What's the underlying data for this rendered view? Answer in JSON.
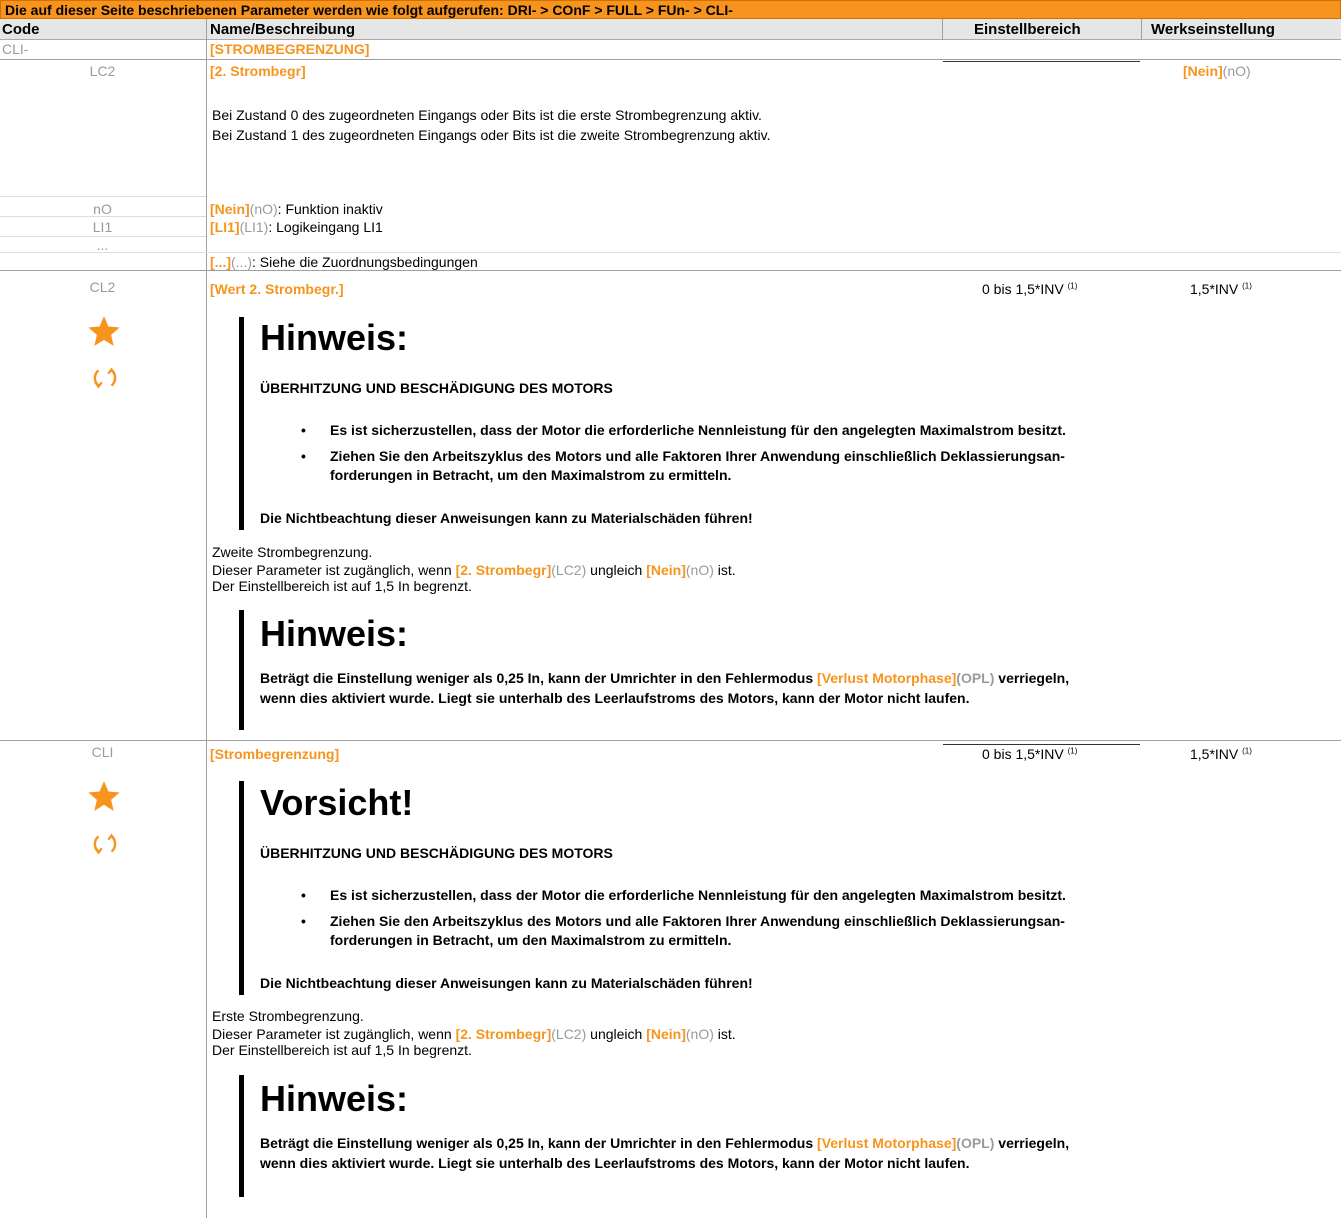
{
  "header": {
    "path_text": "Die auf dieser Seite beschriebenen Parameter werden wie folgt aufgerufen: DRI- > COnF > FULL > FUn- > CLI-",
    "col_code": "Code",
    "col_name": "Name/Beschreibung",
    "col_range": "Einstellbereich",
    "col_default": "Werkseinstellung"
  },
  "menu_row": {
    "code": "CLI-",
    "name": "[STROMBEGRENZUNG]"
  },
  "lc2": {
    "code": "LC2",
    "name": "[2. Strombegr]",
    "default_label": "[Nein]",
    "default_code": "(nO)",
    "desc1": "Bei Zustand 0 des zugeordneten Eingangs oder Bits ist die erste Strombegrenzung aktiv.",
    "desc2": "Bei Zustand 1 des zugeordneten Eingangs oder Bits ist die zweite Strombegrenzung aktiv.",
    "options": [
      {
        "code": "nO",
        "label": "[Nein]",
        "paren": "(nO)",
        "desc": ": Funktion inaktiv"
      },
      {
        "code": "LI1",
        "label": "[LI1]",
        "paren": "(LI1)",
        "desc": ": Logikeingang LI1"
      },
      {
        "code": "...",
        "label": "[...]",
        "paren": "(...)",
        "desc": ": Siehe die Zuordnungsbedingungen"
      }
    ]
  },
  "cl2": {
    "code": "CL2",
    "name": "[Wert 2. Strombegr.]",
    "range": "0 bis 1,5*INV",
    "range_sup": "(1)",
    "default": "1,5*INV",
    "default_sup": "(1)",
    "callout1": {
      "title": "Hinweis:",
      "subtitle": "ÜBERHITZUNG UND BESCHÄDIGUNG DES MOTORS",
      "bullet1": "Es ist sicherzustellen, dass der Motor die erforderliche Nennleistung für den angelegten Maximalstrom besitzt.",
      "bullet2a": "Ziehen Sie den Arbeitszyklus des Motors und alle Faktoren Ihrer Anwendung einschließlich Deklassierungsan-",
      "bullet2b": "forderungen in Betracht, um den Maximalstrom zu ermitteln.",
      "footer": "Die Nichtbeachtung dieser Anweisungen kann zu Materialschäden führen!"
    },
    "desc1": "Zweite Strombegrenzung.",
    "desc2_pre": "Dieser Parameter ist zugänglich, wenn ",
    "desc2_link1": "[2. Strombegr]",
    "desc2_code1": "(LC2)",
    "desc2_mid": " ungleich ",
    "desc2_link2": "[Nein]",
    "desc2_code2": "(nO)",
    "desc2_post": " ist.",
    "desc3": "Der Einstellbereich ist auf 1,5 In begrenzt.",
    "callout2": {
      "title": "Hinweis:",
      "line1_pre": "Beträgt die Einstellung weniger als 0,25 In, kann der Umrichter in den Fehlermodus ",
      "line1_link": "[Verlust Motorphase]",
      "line1_code": "(OPL)",
      "line1_post": " verriegeln,",
      "line2": "wenn dies aktiviert wurde. Liegt sie unterhalb des Leerlaufstroms des Motors, kann der Motor nicht laufen."
    }
  },
  "cli": {
    "code": "CLI",
    "name": "[Strombegrenzung]",
    "range": "0 bis 1,5*INV",
    "range_sup": "(1)",
    "default": "1,5*INV",
    "default_sup": "(1)",
    "callout1": {
      "title": "Vorsicht!",
      "subtitle": "ÜBERHITZUNG UND BESCHÄDIGUNG DES MOTORS",
      "bullet1": "Es ist sicherzustellen, dass der Motor die erforderliche Nennleistung für den angelegten Maximalstrom besitzt.",
      "bullet2a": "Ziehen Sie den Arbeitszyklus des Motors und alle Faktoren Ihrer Anwendung einschließlich Deklassierungsan-",
      "bullet2b": "forderungen in Betracht, um den Maximalstrom zu ermitteln.",
      "footer": "Die Nichtbeachtung dieser Anweisungen kann zu Materialschäden führen!"
    },
    "desc1": "Erste Strombegrenzung.",
    "desc2_pre": "Dieser Parameter ist zugänglich, wenn ",
    "desc2_link1": "[2. Strombegr]",
    "desc2_code1": "(LC2)",
    "desc2_mid": " ungleich ",
    "desc2_link2": "[Nein]",
    "desc2_code2": "(nO)",
    "desc2_post": " ist.",
    "desc3": "Der Einstellbereich ist auf 1,5 In begrenzt.",
    "callout2": {
      "title": "Hinweis:",
      "line1_pre": "Beträgt die Einstellung weniger als 0,25 In, kann der Umrichter in den Fehlermodus ",
      "line1_link": "[Verlust Motorphase]",
      "line1_code": "(OPL)",
      "line1_post": " verriegeln,",
      "line2": "wenn dies aktiviert wurde. Liegt sie unterhalb des Leerlaufstroms des Motors, kann der Motor nicht laufen."
    }
  },
  "icons": {
    "star": "star-icon",
    "rotate": "rotate-icon",
    "accent": "#f7941d"
  }
}
